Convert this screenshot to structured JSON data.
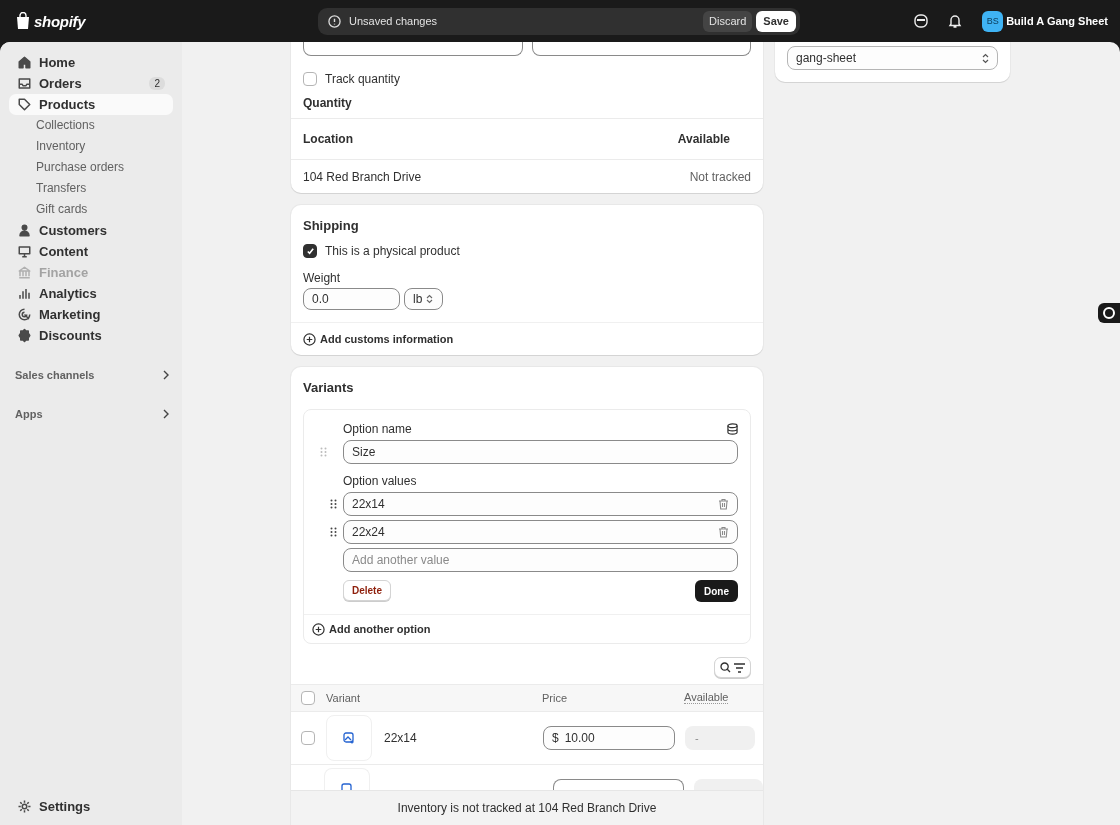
{
  "topbar": {
    "logo": "shopify",
    "save_bar": {
      "message": "Unsaved changes",
      "discard": "Discard",
      "save": "Save"
    },
    "store": {
      "initials": "BS",
      "name": "Build A Gang Sheet"
    }
  },
  "sidebar": {
    "items": [
      {
        "label": "Home",
        "selected": false,
        "disabled": false
      },
      {
        "label": "Orders",
        "selected": false,
        "disabled": false,
        "badge": "2"
      },
      {
        "label": "Products",
        "selected": true,
        "disabled": false,
        "children": [
          {
            "label": "Collections"
          },
          {
            "label": "Inventory"
          },
          {
            "label": "Purchase orders"
          },
          {
            "label": "Transfers"
          },
          {
            "label": "Gift cards"
          }
        ]
      },
      {
        "label": "Customers",
        "selected": false,
        "disabled": false
      },
      {
        "label": "Content",
        "selected": false,
        "disabled": false
      },
      {
        "label": "Finance",
        "selected": false,
        "disabled": true
      },
      {
        "label": "Analytics",
        "selected": false,
        "disabled": false
      },
      {
        "label": "Marketing",
        "selected": false,
        "disabled": false
      },
      {
        "label": "Discounts",
        "selected": false,
        "disabled": false
      }
    ],
    "sections": [
      "Sales channels",
      "Apps"
    ],
    "settings": "Settings"
  },
  "inventory": {
    "track_quantity": {
      "label": "Track quantity",
      "checked": false
    },
    "quantity_title": "Quantity",
    "columns": [
      "Location",
      "Available"
    ],
    "rows": [
      {
        "location": "104 Red Branch Drive",
        "available": "Not tracked"
      }
    ]
  },
  "shipping": {
    "title": "Shipping",
    "physical": {
      "label": "This is a physical product",
      "checked": true
    },
    "weight_label": "Weight",
    "weight": "0.0",
    "unit": "lb",
    "customs": "Add customs information"
  },
  "variants": {
    "title": "Variants",
    "option": {
      "name_label": "Option name",
      "name": "Size",
      "values_label": "Option values",
      "values": [
        "22x14",
        "22x24"
      ],
      "placeholder": "Add another value",
      "delete": "Delete",
      "done": "Done"
    },
    "add_option": "Add another option",
    "table": {
      "select_all": {
        "checked": false
      },
      "columns": [
        "Variant",
        "Price",
        "Available"
      ],
      "rows": [
        {
          "name": "22x14",
          "currency": "$",
          "price": "10.00",
          "available": "-",
          "checked": false
        }
      ]
    },
    "notice": "Inventory is not tracked at 104 Red Branch Drive"
  },
  "template": {
    "value": "gang-sheet"
  }
}
